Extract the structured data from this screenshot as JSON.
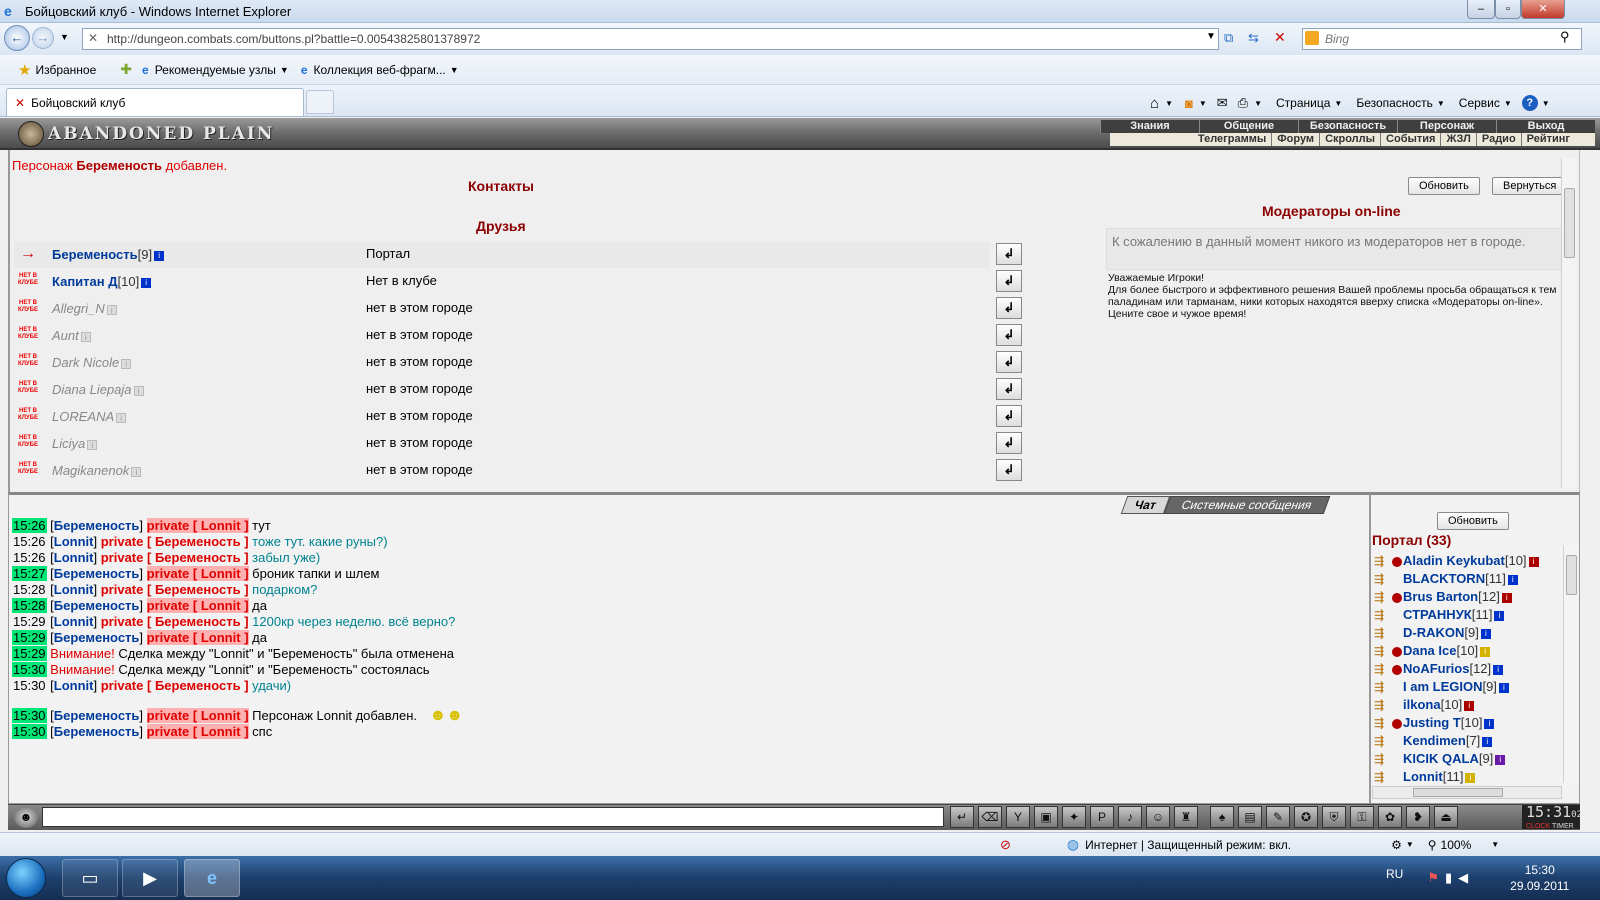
{
  "window": {
    "title": "Бойцовский клуб - Windows Internet Explorer",
    "minimize": "–",
    "maximize": "▫",
    "close": "✕"
  },
  "addressbar": {
    "url": "http://dungeon.combats.com/buttons.pl?battle=0.00543825801378972",
    "search_placeholder": "Bing"
  },
  "favorites": {
    "favorites_label": "Избранное",
    "recommended_label": "Рекомендуемые узлы",
    "webslices_label": "Коллекция веб-фрагм..."
  },
  "tabs": {
    "active_tab": "Бойцовский клуб"
  },
  "commandbar": {
    "page": "Страница",
    "safety": "Безопасность",
    "service": "Сервис"
  },
  "game": {
    "logo": "ABANDONED PLAIN",
    "menu_main": [
      "Знания",
      "Общение",
      "Безопасность",
      "Персонаж",
      "Выход"
    ],
    "menu_sub": [
      "Телеграммы",
      "Форум",
      "Скроллы",
      "События",
      "ЖЗЛ",
      "Радио",
      "Рейтинг"
    ]
  },
  "contacts": {
    "notice_prefix": "Персонаж ",
    "notice_name": "Беременость",
    "notice_suffix": " добавлен.",
    "title": "Контакты",
    "friends_title": "Друзья",
    "refresh_button": "Обновить",
    "back_button": "Вернуться",
    "friends": [
      {
        "name": "Беременость",
        "level": "[9]",
        "location": "Портал",
        "online": true,
        "status": "→"
      },
      {
        "name": "Капитан Д",
        "level": "[10]",
        "location": "Нет в клубе",
        "online": true,
        "status": "НЕТ В КЛУБЕ"
      },
      {
        "name": "Allegri_N",
        "level": "",
        "location": "нет в этом городе",
        "online": false,
        "status": "НЕТ В КЛУБЕ"
      },
      {
        "name": "Aunt",
        "level": "",
        "location": "нет в этом городе",
        "online": false,
        "status": "НЕТ В КЛУБЕ"
      },
      {
        "name": "Dark Nicole",
        "level": "",
        "location": "нет в этом городе",
        "online": false,
        "status": "НЕТ В КЛУБЕ"
      },
      {
        "name": "Diana Liepaja",
        "level": "",
        "location": "нет в этом городе",
        "online": false,
        "status": "НЕТ В КЛУБЕ"
      },
      {
        "name": "LOREANA",
        "level": "",
        "location": "нет в этом городе",
        "online": false,
        "status": "НЕТ В КЛУБЕ"
      },
      {
        "name": "Liciya",
        "level": "",
        "location": "нет в этом городе",
        "online": false,
        "status": "НЕТ В КЛУБЕ"
      },
      {
        "name": "Magikanenok",
        "level": "",
        "location": "нет в этом городе",
        "online": false,
        "status": "НЕТ В КЛУБЕ"
      }
    ]
  },
  "moderators": {
    "title": "Модераторы on-line",
    "none_text": "К сожалению в данный момент никого из модераторов нет в городе.",
    "info_1": "Уважаемые Игроки!",
    "info_2": "Для более быстрого и эффективного решения Вашей проблемы просьба обращаться к тем паладинам или тарманам, ники которых находятся вверху списка «Модераторы on-line».",
    "info_3": "Цените свое и чужое время!"
  },
  "chat": {
    "tab_chat": "Чат",
    "tab_system": "Системные сообщения",
    "lines": [
      {
        "time": "15:26",
        "hl": true,
        "from": "Беременость",
        "to": "Lonnit",
        "msg": "тут",
        "teal": false
      },
      {
        "time": "15:26",
        "hl": false,
        "from": "Lonnit",
        "to": "Беременость",
        "msg": "тоже тут. какие руны?)",
        "teal": true
      },
      {
        "time": "15:26",
        "hl": false,
        "from": "Lonnit",
        "to": "Беременость",
        "msg": "забыл уже)",
        "teal": true
      },
      {
        "time": "15:27",
        "hl": true,
        "from": "Беременость",
        "to": "Lonnit",
        "msg": "броник тапки и шлем",
        "teal": false
      },
      {
        "time": "15:28",
        "hl": false,
        "from": "Lonnit",
        "to": "Беременость",
        "msg": "подарком?",
        "teal": true
      },
      {
        "time": "15:28",
        "hl": true,
        "from": "Беременость",
        "to": "Lonnit",
        "msg": "да",
        "teal": false
      },
      {
        "time": "15:29",
        "hl": false,
        "from": "Lonnit",
        "to": "Беременость",
        "msg": "1200кр через неделю. всё верно?",
        "teal": true
      },
      {
        "time": "15:29",
        "hl": true,
        "from": "Беременость",
        "to": "Lonnit",
        "msg": "да",
        "teal": false
      }
    ],
    "sys_1_time": "15:29",
    "sys_1_warn": "Внимание!",
    "sys_1_text": " Сделка между \"Lonnit\" и \"Беременость\" была отменена",
    "sys_2_time": "15:30",
    "sys_2_warn": "Внимание!",
    "sys_2_text": " Сделка между \"Lonnit\" и \"Беременость\" состоялась",
    "line11_time": "15:30",
    "line11_from": "Lonnit",
    "line11_to": "Беременость",
    "line11_msg": "удачи)",
    "line12_time": "15:30",
    "line12_from": "Беременость",
    "line12_to": "Lonnit",
    "line12_msg": "Персонаж Lonnit добавлен.",
    "line13_time": "15:30",
    "line13_from": "Беременость",
    "line13_to": "Lonnit",
    "line13_msg": "спс",
    "private_word": "private"
  },
  "online": {
    "refresh_button": "Обновить",
    "title": "Портал (33)",
    "players": [
      {
        "name": "Aladin Keykubat",
        "level": "[10]",
        "clan": true,
        "badge": "r"
      },
      {
        "name": "BLACKTORN",
        "level": "[11]",
        "clan": false,
        "badge": ""
      },
      {
        "name": "Brus Barton",
        "level": "[12]",
        "clan": true,
        "badge": "r"
      },
      {
        "name": "СТРАННУК",
        "level": "[11]",
        "clan": false,
        "badge": ""
      },
      {
        "name": "D-RAKON",
        "level": "[9]",
        "clan": false,
        "badge": ""
      },
      {
        "name": "Dana Ice",
        "level": "[10]",
        "clan": true,
        "badge": "y"
      },
      {
        "name": "NoAFurios",
        "level": "[12]",
        "clan": true,
        "badge": ""
      },
      {
        "name": "I am LEGION",
        "level": "[9]",
        "clan": false,
        "badge": ""
      },
      {
        "name": "ilkona",
        "level": "[10]",
        "clan": false,
        "badge": "r"
      },
      {
        "name": "Justing T",
        "level": "[10]",
        "clan": true,
        "badge": ""
      },
      {
        "name": "Kendimen",
        "level": "[7]",
        "clan": false,
        "badge": ""
      },
      {
        "name": "KICIK QALA",
        "level": "[9]",
        "clan": false,
        "badge": "p"
      },
      {
        "name": "Lonnit",
        "level": "[11]",
        "clan": false,
        "badge": "y"
      }
    ]
  },
  "clock": {
    "time": "15:31",
    "seconds": "02",
    "label_1": "CLOCK",
    "label_2": "TIMER"
  },
  "statusbar": {
    "zone": "Интернет | Защищенный режим: вкл.",
    "zoom": "100%"
  },
  "taskbar": {
    "lang": "RU",
    "time": "15:30",
    "date": "29.09.2011"
  }
}
